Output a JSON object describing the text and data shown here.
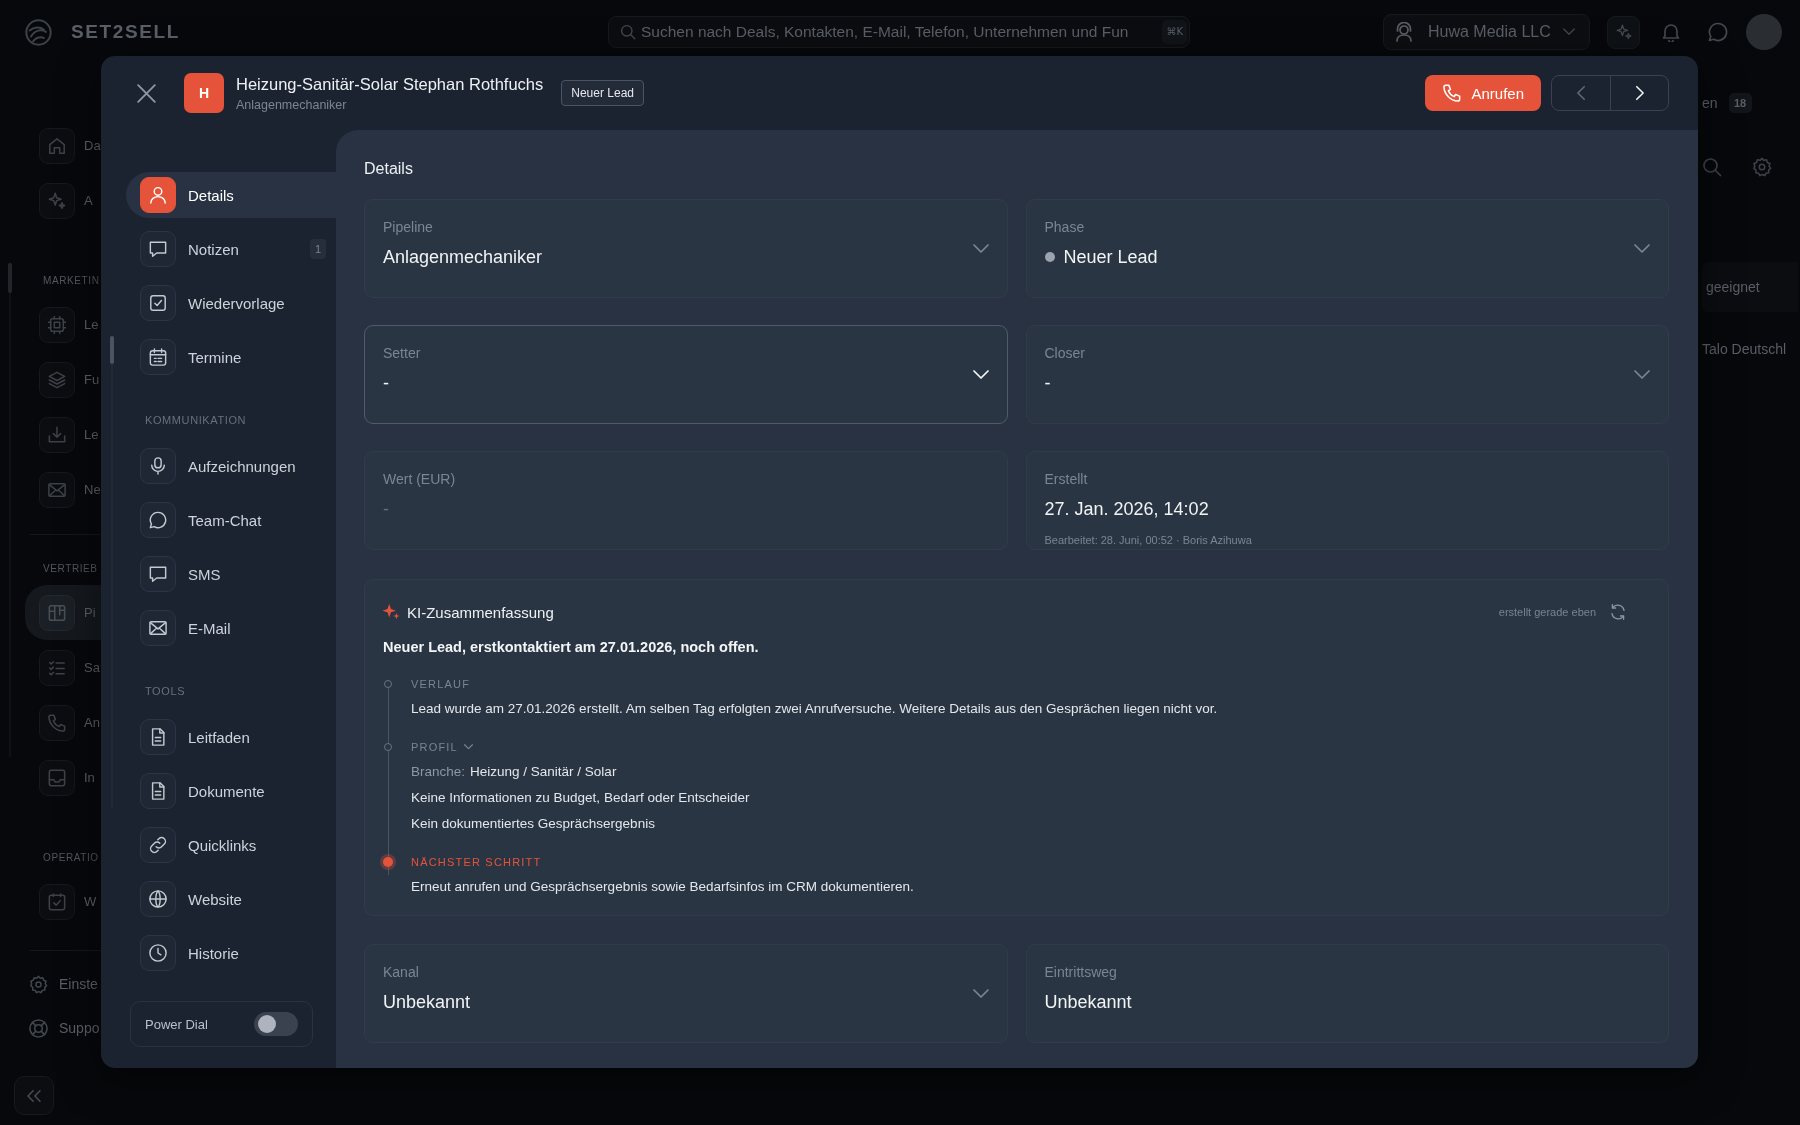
{
  "app": {
    "logo": "SET2SELL",
    "search": {
      "placeholder": "Suchen nach Deals, Kontakten, E-Mail, Telefon, Unternehmen und Fun",
      "shortcut": "⌘K"
    },
    "workspace": "Huwa Media LLC",
    "nav": [
      {
        "kind": "item",
        "label": "Da",
        "selected": false
      },
      {
        "kind": "item",
        "label": "A",
        "selected": false
      },
      {
        "kind": "section",
        "label": "MARKETIN"
      },
      {
        "kind": "item",
        "label": "Le",
        "selected": false
      },
      {
        "kind": "item",
        "label": "Fu",
        "selected": false
      },
      {
        "kind": "item",
        "label": "Le",
        "selected": false
      },
      {
        "kind": "item",
        "label": "Ne",
        "selected": false
      },
      {
        "kind": "divider"
      },
      {
        "kind": "section",
        "label": "VERTRIEB"
      },
      {
        "kind": "item",
        "label": "Pi",
        "selected": true
      },
      {
        "kind": "item",
        "label": "Sa",
        "selected": false
      },
      {
        "kind": "item",
        "label": "An",
        "selected": false
      },
      {
        "kind": "item",
        "label": "In",
        "selected": false
      },
      {
        "kind": "section",
        "label": "OPERATIO"
      },
      {
        "kind": "item",
        "label": "W",
        "selected": false
      }
    ],
    "footer_nav": [
      {
        "label": "Einste"
      },
      {
        "label": "Suppo"
      }
    ],
    "right_panel": {
      "tab": "en",
      "count": "18",
      "cells": [
        "geeignet",
        "Talo Deutschl"
      ]
    }
  },
  "modal": {
    "avatar": "H",
    "title": "Heizung-Sanitär-Solar Stephan Rothfuchs",
    "subtitle": "Anlagenmechaniker",
    "badge": "Neuer Lead",
    "call_button": "Anrufen",
    "pager": [
      {
        "kind": "previous",
        "disabled": true
      },
      {
        "kind": "next",
        "disabled": false
      }
    ],
    "sidebar": {
      "groups": [
        {
          "items": [
            {
              "label": "Details",
              "selected": true
            },
            {
              "label": "Notizen",
              "selected": false,
              "count": "1"
            },
            {
              "label": "Wiedervorlage",
              "selected": false
            },
            {
              "label": "Termine",
              "selected": false
            }
          ]
        },
        {
          "heading": "KOMMUNIKATION",
          "items": [
            {
              "label": "Aufzeichnungen",
              "selected": false
            },
            {
              "label": "Team-Chat",
              "selected": false
            },
            {
              "label": "SMS",
              "selected": false
            },
            {
              "label": "E-Mail",
              "selected": false
            }
          ]
        },
        {
          "heading": "TOOLS",
          "items": [
            {
              "label": "Leitfaden",
              "selected": false
            },
            {
              "label": "Dokumente",
              "selected": false
            },
            {
              "label": "Quicklinks",
              "selected": false
            },
            {
              "label": "Website",
              "selected": false
            },
            {
              "label": "Historie",
              "selected": false
            }
          ]
        }
      ],
      "power_dial": {
        "label": "Power Dial",
        "on": false
      }
    },
    "content": {
      "heading": "Details",
      "fields": [
        {
          "kind": "select",
          "label": "Pipeline",
          "value": "Anlagenmechaniker",
          "focused": false
        },
        {
          "kind": "select",
          "label": "Phase",
          "value": "Neuer Lead",
          "color": "#9ca3af",
          "focused": false
        },
        {
          "kind": "select",
          "label": "Setter",
          "value": "-",
          "focused": true
        },
        {
          "kind": "select",
          "label": "Closer",
          "value": "-",
          "focused": false
        },
        {
          "kind": "input",
          "label": "Wert (EUR)",
          "placeholder": "-",
          "focused": false
        },
        {
          "kind": "info",
          "label": "Erstellt",
          "value": "27. Jan. 2026, 14:02",
          "note": "Bearbeitet: 28. Juni, 00:52 · Boris Azihuwa"
        }
      ],
      "summary": {
        "title": "KI-Zusammenfassung",
        "timestamp": "erstellt gerade eben",
        "headline": "Neuer Lead, erstkontaktiert am 27.01.2026, noch offen.",
        "sections": [
          {
            "kind": "plain",
            "heading": "VERLAUF",
            "lines": [
              {
                "text": "Lead wurde am 27.01.2026 erstellt. Am selben Tag erfolgten zwei Anrufversuche. Weitere Details aus den Gesprächen liegen nicht vor."
              }
            ]
          },
          {
            "kind": "collapsible",
            "heading": "PROFIL",
            "expanded": true,
            "lines": [
              {
                "label": "Branche:",
                "text": "Heizung / Sanitär / Solar"
              },
              {
                "text": "Keine Informationen zu Budget, Bedarf oder Entscheider"
              },
              {
                "text": "Kein dokumentiertes Gesprächsergebnis"
              }
            ]
          },
          {
            "kind": "highlight",
            "heading": "NÄCHSTER SCHRITT",
            "lines": [
              {
                "text": "Erneut anrufen und Gesprächsergebnis sowie Bedarfsinfos im CRM dokumentieren."
              }
            ]
          }
        ]
      },
      "bottom_fields": [
        {
          "kind": "select",
          "label": "Kanal",
          "value": "Unbekannt",
          "focused": false
        },
        {
          "kind": "info",
          "label": "Eintrittsweg",
          "value": "Unbekannt"
        }
      ]
    }
  }
}
